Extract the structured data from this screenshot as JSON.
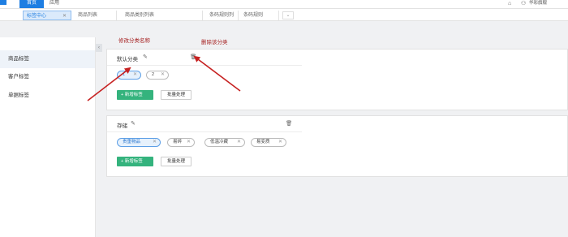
{
  "topbar": {
    "home_label": "首页",
    "app_label": "应用",
    "user_name": "华彩旗舰",
    "icons": [
      "home-icon",
      "user-icon"
    ]
  },
  "tabs": [
    {
      "label": "标签中心",
      "active": true,
      "closable": true
    },
    {
      "label": "商品列表",
      "active": false
    },
    {
      "label": "商品类别列表",
      "active": false
    },
    {
      "label": "条码规则列表",
      "active": false
    },
    {
      "label": "条码规则",
      "active": false
    }
  ],
  "sidebar": {
    "items": [
      {
        "label": "商品标签",
        "active": true
      },
      {
        "label": "客户标签",
        "active": false
      },
      {
        "label": "单据标签",
        "active": false
      }
    ],
    "collapse_glyph": "‹"
  },
  "groups": [
    {
      "name": "默认分类",
      "tags": [
        {
          "label": "1",
          "selected": true
        },
        {
          "label": "2",
          "selected": false
        }
      ],
      "add_label": "+ 新增标签",
      "batch_label": "批量处理"
    },
    {
      "name": "存储",
      "tags": [
        {
          "label": "贵重物品",
          "selected": true
        },
        {
          "label": "易碎",
          "selected": false
        },
        {
          "label": "低温冷藏",
          "selected": false
        },
        {
          "label": "易变质",
          "selected": false
        }
      ],
      "add_label": "+ 新增标签",
      "batch_label": "批量处理"
    }
  ],
  "annotations": {
    "rename": "修改分类名称",
    "delete": "删除该分类"
  },
  "colors": {
    "primary": "#1e7ee2",
    "green": "#34b37d",
    "annotation": "#a51f1f"
  }
}
